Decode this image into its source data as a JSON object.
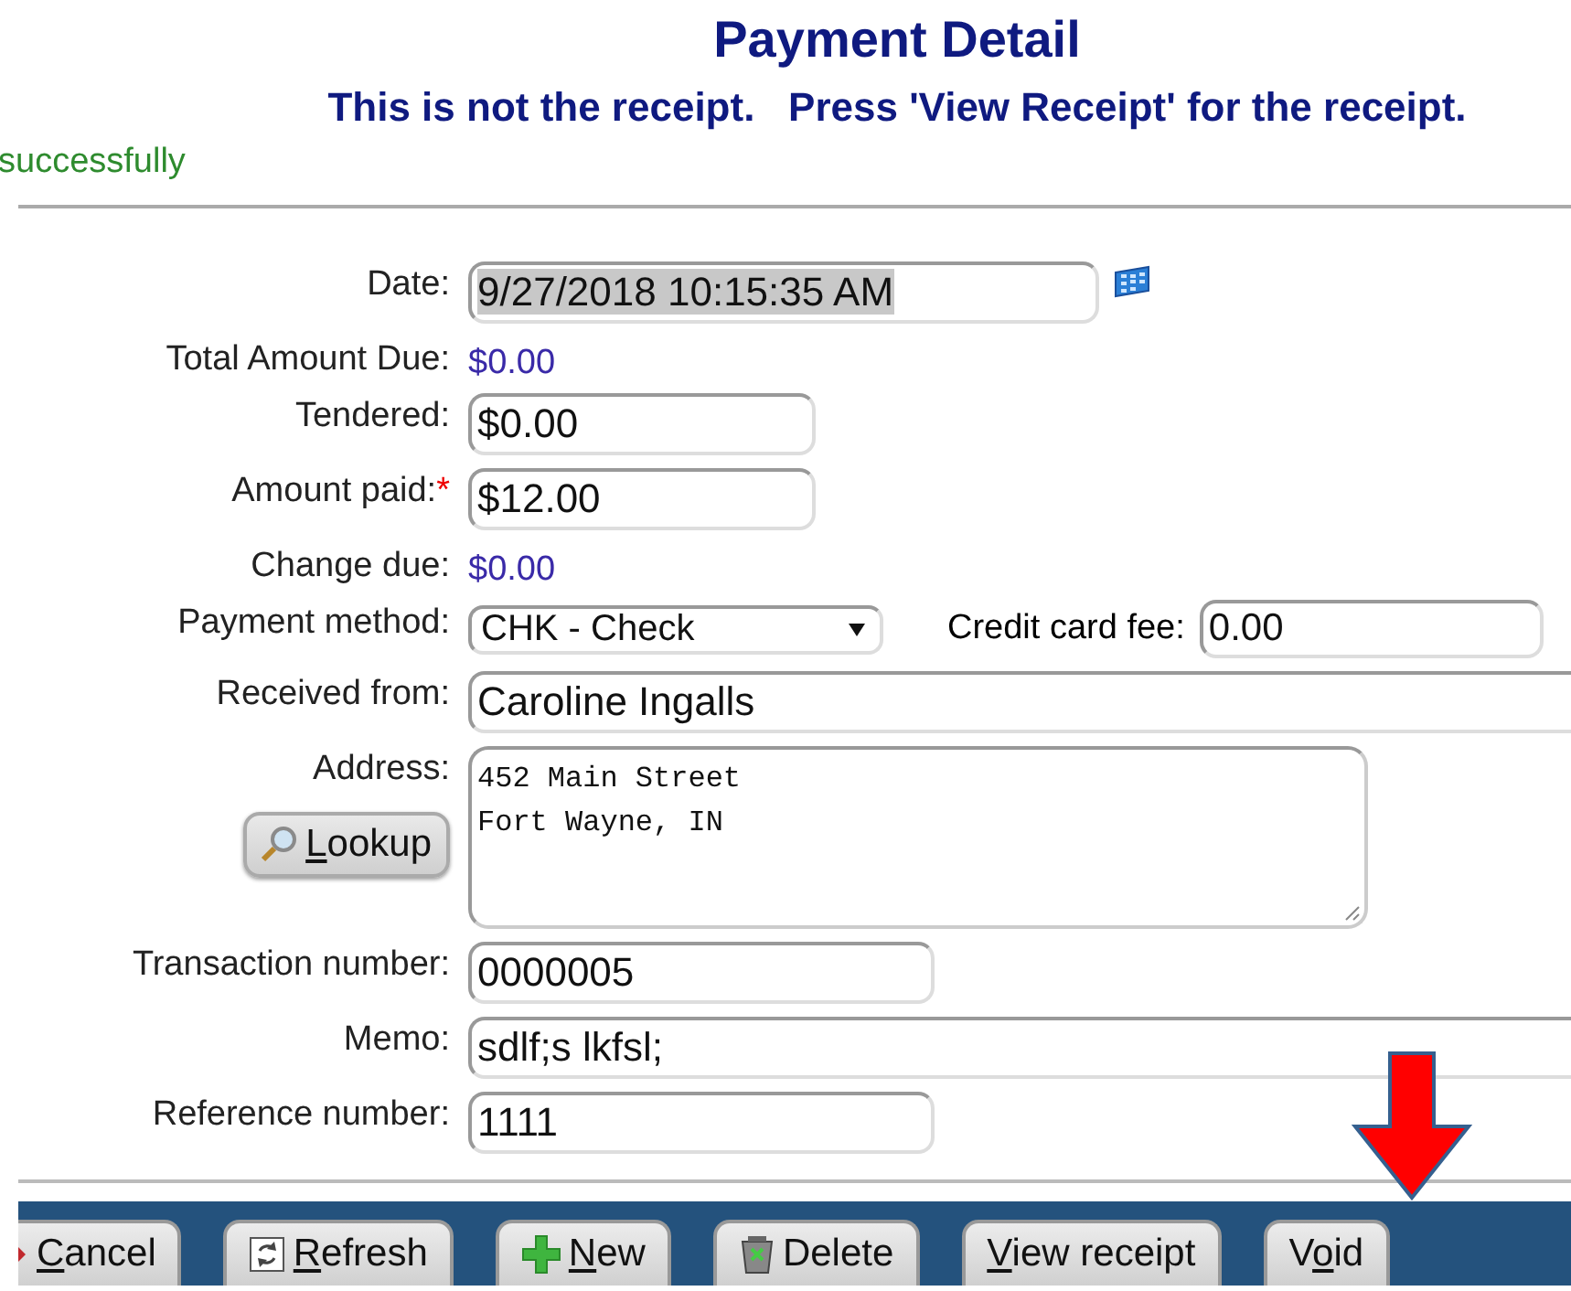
{
  "header": {
    "title": "Payment Detail",
    "subtitle": "This is not the receipt.   Press 'View Receipt' for the receipt.",
    "message": "successfully"
  },
  "form": {
    "rows": [
      {
        "kind": "date",
        "label": "Date:",
        "value": "9/27/2018 10:15:35 AM",
        "highlighted": true
      },
      {
        "kind": "text",
        "label": "Total Amount Due:",
        "value": "$0.00"
      },
      {
        "kind": "short",
        "label": "Tendered:",
        "value": "$0.00"
      },
      {
        "kind": "short",
        "label": "Amount paid:",
        "required_mark": "*",
        "value": "$12.00"
      },
      {
        "kind": "text",
        "label": "Change due:",
        "value": "$0.00"
      },
      {
        "kind": "select",
        "label": "Payment method:",
        "value": "CHK - Check",
        "extra_label": "Credit card fee:",
        "extra_value": "0.00"
      },
      {
        "kind": "wide",
        "label": "Received from:",
        "value": "Caroline Ingalls"
      },
      {
        "kind": "textarea",
        "label": "Address:",
        "lines": [
          "452 Main Street",
          "Fort Wayne, IN"
        ],
        "button": {
          "key": "L",
          "after": "ookup"
        }
      },
      {
        "kind": "medium",
        "label": "Transaction number:",
        "value": "0000005"
      },
      {
        "kind": "wide",
        "label": "Memo:",
        "value": "sdlf;s lkfsl;"
      },
      {
        "kind": "medium",
        "label": "Reference number:",
        "value": "1111"
      }
    ]
  },
  "toolbar": {
    "buttons": [
      {
        "kind": "cancel",
        "key": "C",
        "after": "ancel"
      },
      {
        "kind": "refresh",
        "key": "R",
        "after": "efresh"
      },
      {
        "kind": "new",
        "key": "N",
        "after": "ew"
      },
      {
        "kind": "delete",
        "before": "Delete"
      },
      {
        "kind": "plain",
        "key": "V",
        "after": "iew receipt"
      },
      {
        "kind": "plain",
        "before": "V",
        "key": "o",
        "after": "id"
      }
    ]
  }
}
